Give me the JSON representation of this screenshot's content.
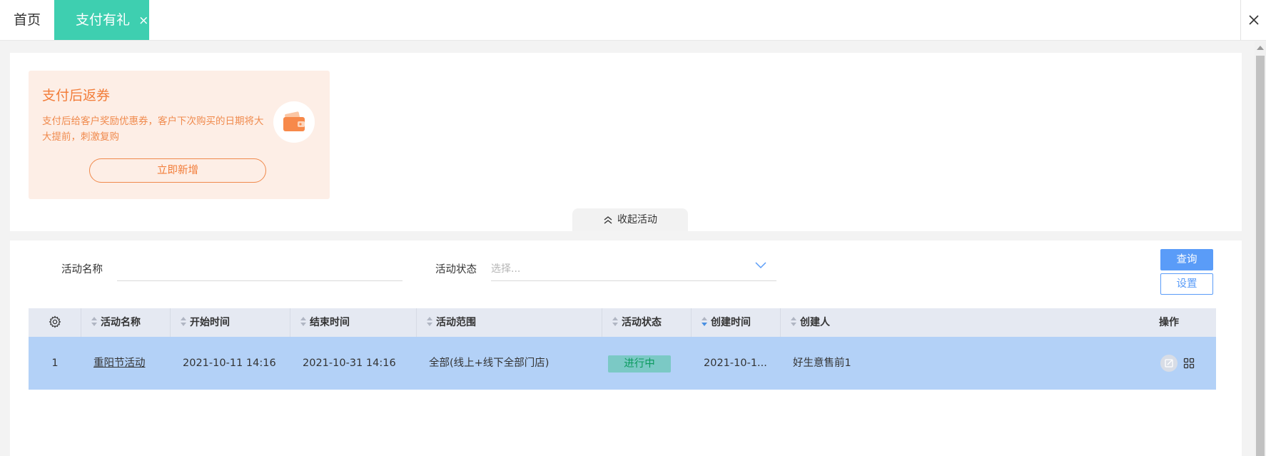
{
  "tabs": {
    "home": "首页",
    "active": "支付有礼",
    "active_close": "×"
  },
  "promo": {
    "title": "支付后返券",
    "description": "支付后给客户奖励优惠券，客户下次购买的日期将大大提前，刺激复购",
    "button": "立即新增",
    "icon": "wallet-icon"
  },
  "collapse_label": "收起活动",
  "filters": {
    "name_label": "活动名称",
    "name_value": "",
    "status_label": "活动状态",
    "status_placeholder": "选择..."
  },
  "buttons": {
    "query": "查询",
    "settings": "设置"
  },
  "table": {
    "columns": [
      "活动名称",
      "开始时间",
      "结束时间",
      "活动范围",
      "活动状态",
      "创建时间",
      "创建人",
      "操作"
    ],
    "rows": [
      {
        "index": "1",
        "name": "重阳节活动",
        "start": "2021-10-11 14:16",
        "end": "2021-10-31 14:16",
        "scope": "全部(线上+线下全部门店)",
        "status": "进行中",
        "created": "2021-10-1...",
        "creator": "好生意售前1"
      }
    ]
  },
  "colors": {
    "accent_tab": "#3ecfb0",
    "primary": "#5a9cf8",
    "promo_bg": "#fdeee6",
    "promo_text": "#f27d3a",
    "selected_row": "#b3d1f7",
    "status_bg": "#7bc9c5"
  }
}
